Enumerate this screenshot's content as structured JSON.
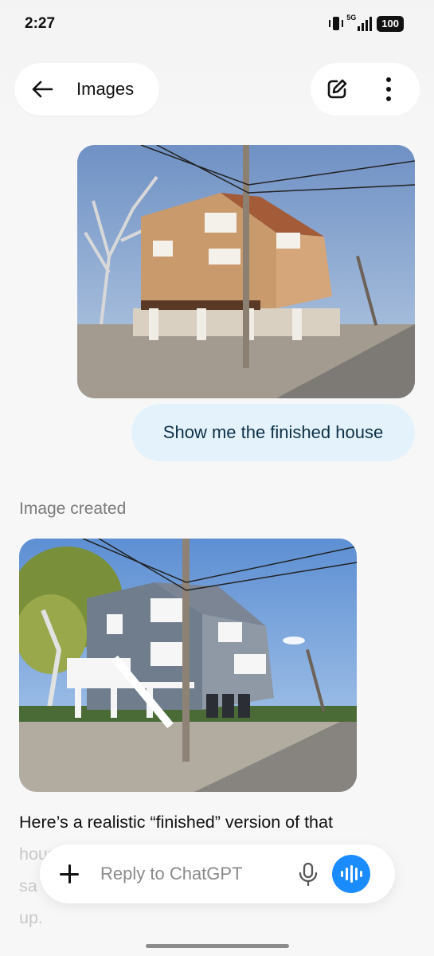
{
  "status_bar": {
    "time": "2:27",
    "network": "5G",
    "battery": "100"
  },
  "header": {
    "title": "Images"
  },
  "icons": {
    "back": "arrow-left-icon",
    "edit": "edit-icon",
    "more": "more-vertical-icon",
    "plus": "plus-icon",
    "mic": "microphone-icon",
    "voice": "voice-waveform-icon"
  },
  "chat": {
    "user_message": "Show me the finished house",
    "image_status": "Image created",
    "reply_line1": "Here’s a realistic “finished” version of that",
    "reply_line2": "house based on your construction photo —",
    "reply_line3": "sa",
    "reply_line4": "up."
  },
  "composer": {
    "placeholder": "Reply to ChatGPT"
  },
  "colors": {
    "accent": "#1a8cff",
    "user_bubble": "#e4f2fb"
  }
}
